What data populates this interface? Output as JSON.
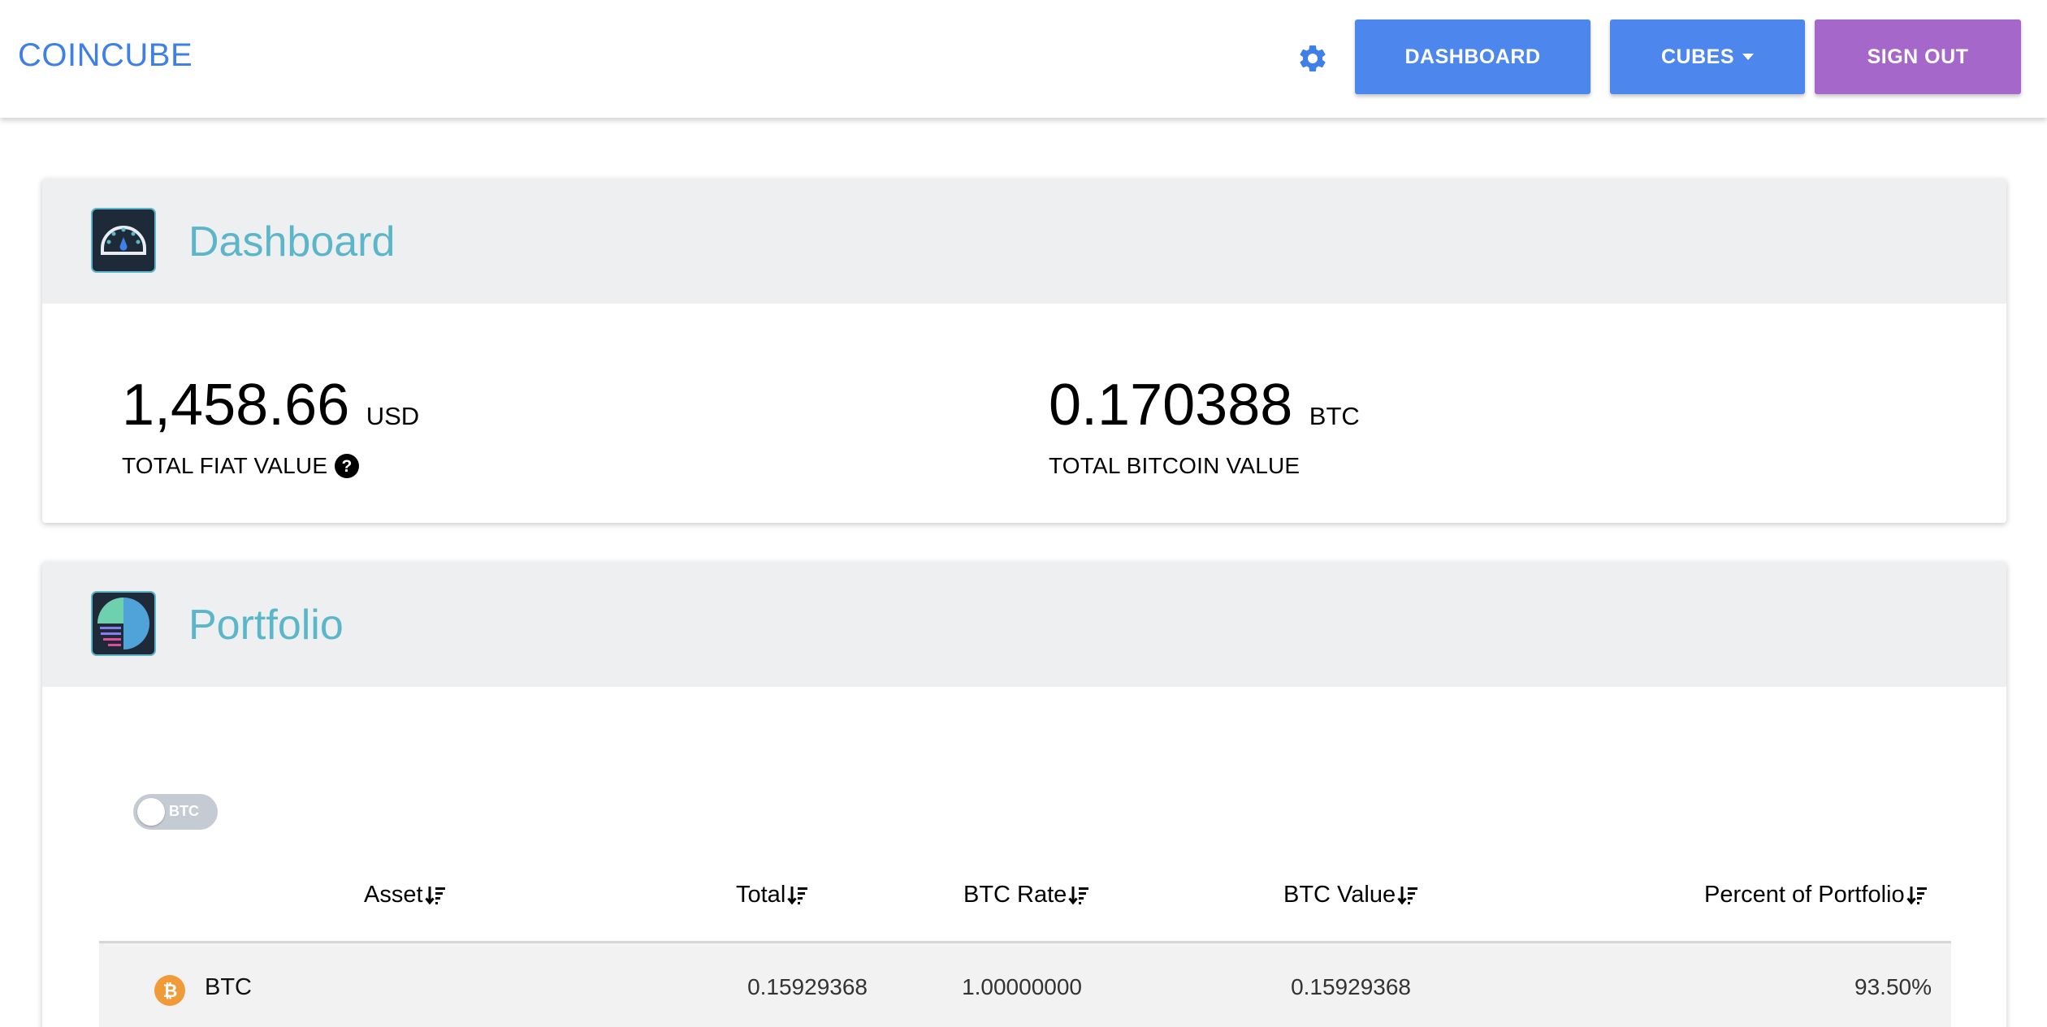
{
  "nav": {
    "brand": "COINCUBE",
    "settings_icon": "gear-icon",
    "dashboard_label": "DASHBOARD",
    "cubes_label": "CUBES",
    "signout_label": "SIGN OUT",
    "colors": {
      "brand": "#3f7fe8",
      "primary": "#4d87ee",
      "signout": "#a567c9"
    }
  },
  "dashboard": {
    "title": "Dashboard",
    "icon": "speedometer-icon",
    "fiat": {
      "value": "1,458.66",
      "unit": "USD",
      "label": "TOTAL FIAT VALUE",
      "help_icon": "question-circle-icon"
    },
    "btc": {
      "value": "0.170388",
      "unit": "BTC",
      "label": "TOTAL BITCOIN VALUE"
    }
  },
  "portfolio": {
    "title": "Portfolio",
    "icon": "pie-chart-icon",
    "toggle_label": "BTC",
    "columns": [
      "Asset",
      "Total",
      "BTC Rate",
      "BTC Value",
      "Percent of Portfolio"
    ],
    "rows": [
      {
        "icon": "bitcoin-icon",
        "asset": "BTC",
        "total": "0.15929368",
        "btc_rate": "1.00000000",
        "btc_value": "0.15929368",
        "percent": "93.50%"
      }
    ]
  }
}
